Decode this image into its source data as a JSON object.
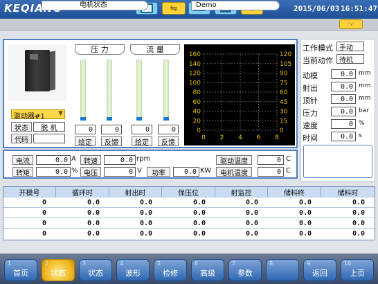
{
  "header": {
    "logo": "KEQIANG",
    "date": "2015/06/03",
    "time": "16:51:47"
  },
  "tabs": {
    "tab1": "电机状态",
    "tab2": "Demo"
  },
  "drive": {
    "selector": "驱动器#1",
    "status_label": "状态",
    "status_value": "脱  机",
    "code_label": "代码",
    "code_value": ""
  },
  "gauges": {
    "pressure_title": "压 力",
    "flow_title": "流 量",
    "values": [
      "0",
      "0",
      "0",
      "0"
    ],
    "labels": [
      "给定",
      "反馈",
      "给定",
      "反馈"
    ]
  },
  "scope": {
    "left_ticks": [
      "160",
      "140",
      "120",
      "100",
      "80",
      "60",
      "40",
      "20",
      "0"
    ],
    "right_ticks": [
      "120",
      "105",
      "90",
      "75",
      "60",
      "45",
      "30",
      "15",
      "0"
    ],
    "x_ticks": [
      "0",
      "2",
      "4",
      "6",
      "8"
    ],
    "colors": {
      "left": "#e6c100",
      "right": "#e6c100",
      "x": "#ffd400",
      "grid": "#5a5a5a",
      "bg": "#000000"
    }
  },
  "meters": {
    "current_label": "电流",
    "current_value": "0.0",
    "current_unit": "A",
    "torque_label": "转矩",
    "torque_value": "0.0",
    "torque_unit": "%",
    "speed_label": "转速",
    "speed_value": "0.0",
    "speed_unit": "rpm",
    "voltage_label": "电压",
    "voltage_value": "0",
    "voltage_unit": "V",
    "power_label": "功率",
    "power_value": "0.0",
    "power_unit": "KW",
    "drive_temp_label": "驱动温度",
    "drive_temp_value": "0",
    "drive_temp_unit": "C",
    "motor_temp_label": "电机温度",
    "motor_temp_value": "0",
    "motor_temp_unit": "C"
  },
  "side": {
    "mode_label": "工作模式",
    "mode_value": "手动",
    "action_label": "当前动作",
    "action_value": "待机",
    "rows": [
      {
        "label": "动模",
        "value": "0.0",
        "unit": "mm"
      },
      {
        "label": "射出",
        "value": "0.0",
        "unit": "mm"
      },
      {
        "label": "顶针",
        "value": "0.0",
        "unit": "mm"
      },
      {
        "label": "压力",
        "value": "0.0",
        "unit": "bar"
      },
      {
        "label": "速度",
        "value": "0",
        "unit": "%"
      },
      {
        "label": "时间",
        "value": "0.0",
        "unit": "s"
      }
    ]
  },
  "table": {
    "headers": [
      "开模号",
      "循环时",
      "射出时",
      "保压位",
      "射监控",
      "储料终",
      "储料时"
    ],
    "rows": [
      [
        "0",
        "0.0",
        "0.0",
        "0.0",
        "0.0",
        "0.0",
        "0.0"
      ],
      [
        "0",
        "0.0",
        "0.0",
        "0.0",
        "0.0",
        "0.0",
        "0.0"
      ],
      [
        "0",
        "0.0",
        "0.0",
        "0.0",
        "0.0",
        "0.0",
        "0.0"
      ],
      [
        "0",
        "0.0",
        "0.0",
        "0.0",
        "0.0",
        "0.0",
        "0.0"
      ]
    ]
  },
  "footer": [
    {
      "num": "1",
      "label": "首页"
    },
    {
      "num": "2",
      "label": "状态"
    },
    {
      "num": "3",
      "label": "状态"
    },
    {
      "num": "4",
      "label": "波形"
    },
    {
      "num": "5",
      "label": "检修"
    },
    {
      "num": "6",
      "label": "高级"
    },
    {
      "num": "7",
      "label": "参数"
    },
    {
      "num": "8",
      "label": ""
    },
    {
      "num": "9",
      "label": "返回"
    },
    {
      "num": "10",
      "label": "上页"
    }
  ]
}
